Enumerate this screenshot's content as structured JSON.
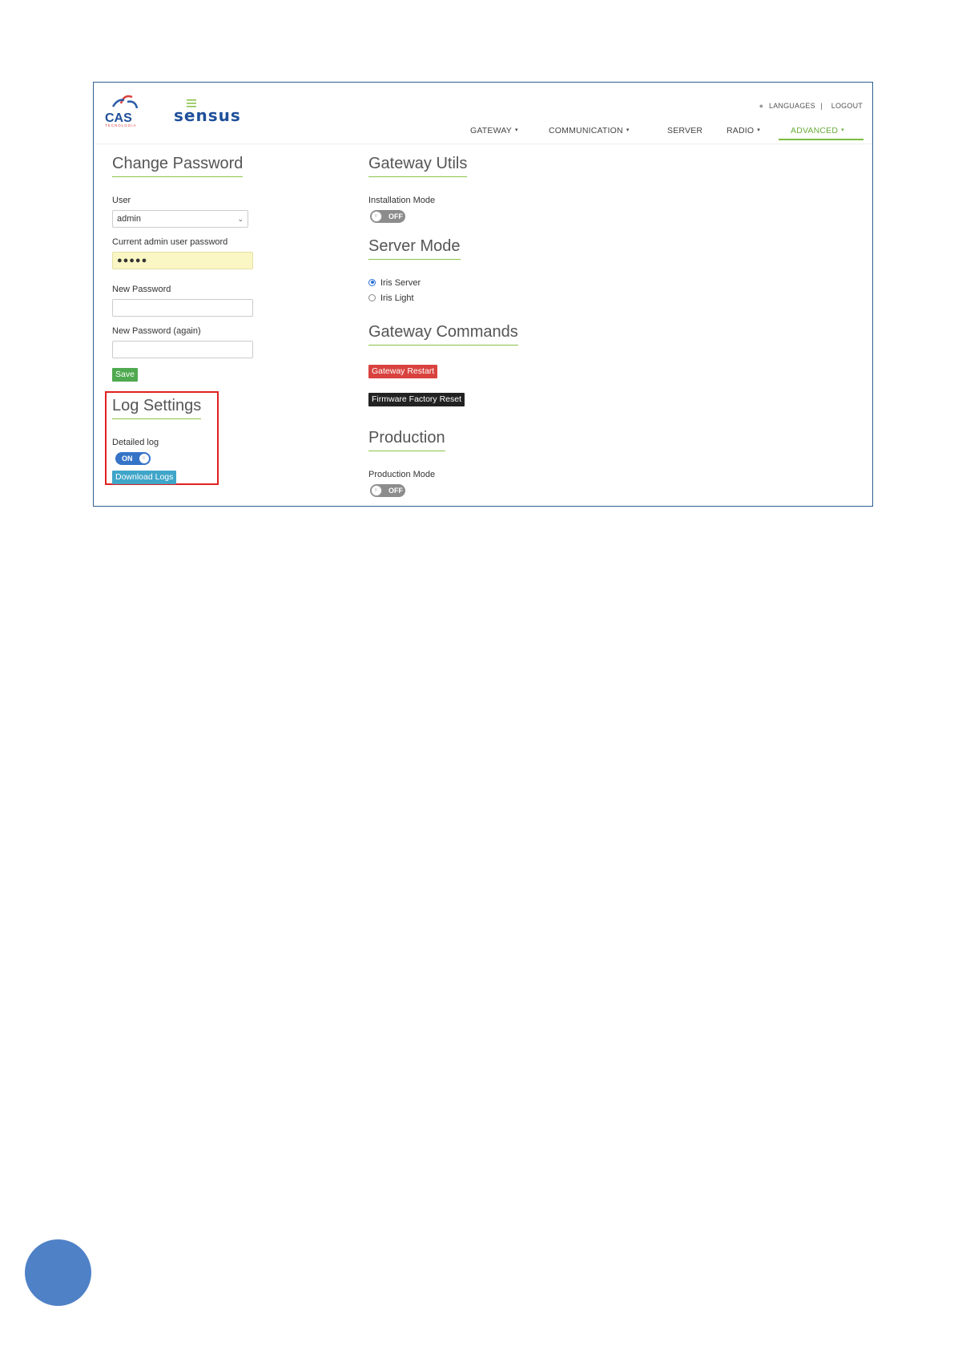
{
  "header": {
    "top_links": {
      "languages": "LANGUAGES",
      "separator": "|",
      "logout": "LOGOUT"
    },
    "cas_logo": {
      "text": "CAS",
      "subtext": "TECNOLOGIA"
    },
    "sensus_logo": {
      "text": "sensus"
    },
    "nav": [
      {
        "label": "GATEWAY",
        "has_caret": true
      },
      {
        "label": "COMMUNICATION",
        "has_caret": true
      },
      {
        "label": "SERVER",
        "has_caret": false
      },
      {
        "label": "RADIO",
        "has_caret": true
      },
      {
        "label": "ADVANCED",
        "has_caret": true,
        "active": true
      }
    ]
  },
  "change_password": {
    "title": "Change Password",
    "user_label": "User",
    "user_value": "admin",
    "current_password_label": "Current admin user password",
    "current_password_value": "●●●●●",
    "new_password_label": "New Password",
    "new_password_again_label": "New Password (again)",
    "save_label": "Save"
  },
  "log_settings": {
    "title": "Log Settings",
    "detailed_log_label": "Detailed log",
    "detailed_log_toggle": "ON",
    "download_label": "Download Logs"
  },
  "gateway_utils": {
    "title": "Gateway Utils",
    "installation_mode_label": "Installation Mode",
    "installation_mode_toggle": "OFF"
  },
  "server_mode": {
    "title": "Server Mode",
    "options": [
      {
        "label": "Iris Server",
        "checked": true
      },
      {
        "label": "Iris Light",
        "checked": false
      }
    ]
  },
  "gateway_commands": {
    "title": "Gateway Commands",
    "restart_label": "Gateway Restart",
    "factory_reset_label": "Firmware Factory Reset"
  },
  "production": {
    "title": "Production",
    "production_mode_label": "Production Mode",
    "production_mode_toggle": "OFF"
  },
  "colors": {
    "accent_green": "#8ac24a",
    "active_nav": "#6aab3a",
    "save": "#4fa94f",
    "download": "#3fa5c9",
    "restart": "#d9433f",
    "factory_reset": "#222222",
    "toggle_on": "#3573c7",
    "toggle_off": "#8c8c8c",
    "highlight": "#e02020",
    "page_circle": "#4f81c7"
  }
}
